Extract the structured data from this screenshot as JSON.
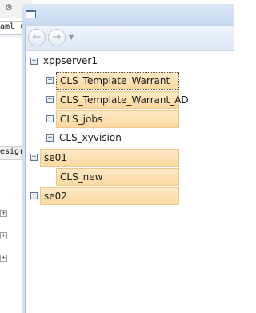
{
  "background_ide": {
    "tab_label": "aml (",
    "status_text": "esigr",
    "expander_glyph": "+"
  },
  "window": {
    "nav": {
      "back_glyph": "←",
      "forward_glyph": "→",
      "dropdown_glyph": "▼"
    },
    "tree": {
      "nodes": [
        {
          "label": "xppserver1",
          "expander": "−",
          "selected": false
        },
        {
          "label": "CLS_Template_Warrant",
          "expander": "+",
          "selected": true,
          "focused": true
        },
        {
          "label": "CLS_Template_Warrant_AD",
          "expander": "+",
          "selected": true
        },
        {
          "label": "CLS_jobs",
          "expander": "+",
          "selected": true
        },
        {
          "label": "CLS_xyvision",
          "expander": "+",
          "selected": false
        },
        {
          "label": "se01",
          "expander": "−",
          "selected": true
        },
        {
          "label": "CLS_new",
          "expander": "",
          "selected": true
        },
        {
          "label": "se02",
          "expander": "+",
          "selected": true
        }
      ]
    }
  },
  "colors": {
    "selection_top": "#fde9c6",
    "selection_bottom": "#fcd9a0",
    "selection_border": "#eec88a",
    "title_bar": "#cfe0f2"
  }
}
